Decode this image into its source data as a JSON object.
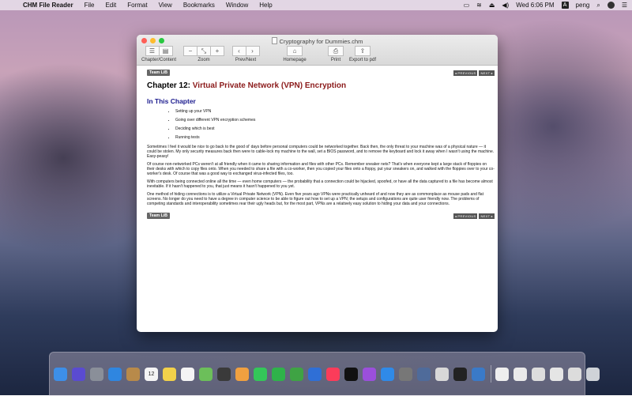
{
  "menubar": {
    "app_name": "CHM File Reader",
    "menus": [
      "File",
      "Edit",
      "Format",
      "View",
      "Bookmarks",
      "Window",
      "Help"
    ],
    "clock": "Wed 6:06 PM",
    "user": "peng",
    "input_badge": "A"
  },
  "window": {
    "title": "Cryptography for Dummies.chm",
    "toolbar": {
      "chapter_content": "Chapter/Content",
      "zoom": "Zoom",
      "prev_next": "Prev/Next",
      "homepage": "Homepage",
      "print": "Print",
      "export": "Export to pdf"
    }
  },
  "content": {
    "team_lib": "Team LiB",
    "previous": "◂ PREVIOUS",
    "next": "NEXT ▸",
    "chapter_number": "Chapter 12:",
    "chapter_title": "Virtual Private Network (VPN) Encryption",
    "section_heading": "In This Chapter",
    "bullets": [
      "Setting up your VPN",
      "Going over different VPN encryption schemes",
      "Deciding which is best",
      "Running tests"
    ],
    "paragraphs": [
      "Sometimes I feel it would be nice to go back to the good ol' days before personal computers could be networked together. Back then, the only threat to your machine was of a physical nature — it could be stolen. My only security measures back then were to cable-lock my machine to the wall, set a BIOS password, and to remove the keyboard and lock it away when I wasn't using the machine. Easy-peasy!",
      "Of course non-networked PCs weren't at all friendly when it came to sharing information and files with other PCs. Remember sneaker nets? That's when everyone kept a large stack of floppies on their desks with which to copy files onto. When you needed to share a file with a co-worker, then you copied your files onto a floppy, put your sneakers on, and walked with the floppies over to your co-worker's desk. Of course that was a good way to exchanged virus-infected files, too.",
      "With computers being connected online all the time — even home computers — the probability that a connection could be hijacked, spoofed, or have all the data captured to a file has become almost inevitable. If it hasn't happened to you, that just means it hasn't happened to you yet.",
      "One method of hiding connections is to utilize a Virtual Private Network (VPN). Even five years ago VPNs were practically unheard of and now they are as commonplace as mouse pads and flat screens. No longer do you need to have a degree in computer science to be able to figure out how to set up a VPN; the setups and configurations are quite user friendly now. The problems of competing standards and interoperability sometimes rear their ugly heads but, for the most part, VPNs are a relatively easy solution to hiding your data and your connections."
    ]
  },
  "dock": {
    "calendar_day": "12",
    "items": [
      {
        "name": "finder-icon",
        "color": "#3d8fe8"
      },
      {
        "name": "siri-icon",
        "color": "#5a4bd1"
      },
      {
        "name": "launchpad-icon",
        "color": "#8a8f99"
      },
      {
        "name": "safari-icon",
        "color": "#2f86e0"
      },
      {
        "name": "notes-book-icon",
        "color": "#b88a4a"
      },
      {
        "name": "calendar-icon",
        "color": "#f4f4f4"
      },
      {
        "name": "notes-icon",
        "color": "#f2d14a"
      },
      {
        "name": "reminders-icon",
        "color": "#f4f4f4"
      },
      {
        "name": "maps-icon",
        "color": "#6cbf5a"
      },
      {
        "name": "photo-booth-icon",
        "color": "#3a3a3a"
      },
      {
        "name": "photos-icon",
        "color": "#f0a040"
      },
      {
        "name": "messages-icon",
        "color": "#34c759"
      },
      {
        "name": "facetime-icon",
        "color": "#2fb34a"
      },
      {
        "name": "numbers-icon",
        "color": "#3fa344"
      },
      {
        "name": "keynote-icon",
        "color": "#2f6fd6"
      },
      {
        "name": "music-icon",
        "color": "#fb3c5a"
      },
      {
        "name": "tv-icon",
        "color": "#111111"
      },
      {
        "name": "podcasts-icon",
        "color": "#9b4fdc"
      },
      {
        "name": "app-store-icon",
        "color": "#2f8ae8"
      },
      {
        "name": "system-preferences-icon",
        "color": "#777777"
      },
      {
        "name": "preview-icon",
        "color": "#4f6b9a"
      },
      {
        "name": "utility-icon",
        "color": "#d8d8d8"
      },
      {
        "name": "terminal-icon",
        "color": "#222222"
      },
      {
        "name": "chm-reader-icon",
        "color": "#3a7ac8"
      }
    ],
    "right_items": [
      {
        "name": "document-icon",
        "color": "#eeeeee"
      },
      {
        "name": "downloads-icon",
        "color": "#eaeaea"
      },
      {
        "name": "screenshot-thumb-icon",
        "color": "#dddddd"
      },
      {
        "name": "screenshot-thumb-icon-2",
        "color": "#e5e5e5"
      },
      {
        "name": "screenshot-thumb-icon-3",
        "color": "#dcdcdc"
      },
      {
        "name": "trash-icon",
        "color": "#cfd3d8"
      }
    ]
  }
}
